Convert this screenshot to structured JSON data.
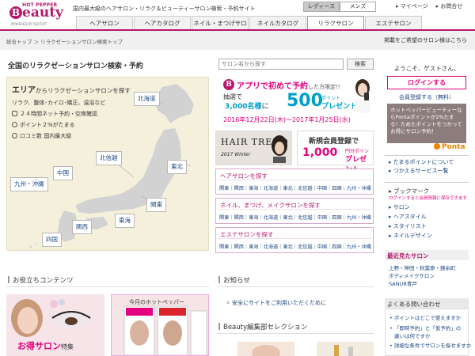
{
  "header": {
    "logo_small": "HOT PEPPER",
    "logo_letter": "B",
    "logo_word": "eauty",
    "logo_by": "POWERED BY RECRUIT",
    "tagline": "国内最大級のヘアサロン・リラク＆ビューティーサロン検索・予約サイト",
    "gender_tabs": [
      {
        "label": "レディース"
      },
      {
        "label": "メンズ"
      }
    ],
    "util_links": [
      "マイページ",
      "お問合せ"
    ],
    "nav_tabs": [
      {
        "label": "ヘアサロン"
      },
      {
        "label": "ヘアカタログ"
      },
      {
        "label": "ネイル・まつげサロン"
      },
      {
        "label": "ネイルカタログ"
      },
      {
        "label": "リラクサロン"
      },
      {
        "label": "エステサロン"
      }
    ]
  },
  "breadcrumb": {
    "text": "総合トップ ＞ リラクゼーションサロン検索トップ",
    "right": "掲載をご希望のサロン様はこちら"
  },
  "main": {
    "title": "全国のリラクゼーションサロン検索・予約",
    "search_placeholder": "サロン名から探す",
    "search_button": "検索"
  },
  "area": {
    "heading_bold": "エリア",
    "heading_rest": "からリラクゼーションサロンを探す",
    "features": [
      "リラク、整体･カイロ･矯正、温浴など",
      "２４時間ネット予約・空席確認",
      "ポイント２%がたまる",
      "口コミ数 国内最大級"
    ],
    "regions": {
      "hokkaido": "北海道",
      "tohoku": "東北",
      "hokushinetsu": "北信越",
      "kanto": "関東",
      "tokai": "東海",
      "kansai": "関西",
      "chugoku": "中国",
      "shikoku": "四国",
      "kyushu": "九州・沖縄"
    }
  },
  "promo_app": {
    "badge": "B",
    "line1": "アプリで初めて予約",
    "line1_tail": "した方限定!!",
    "line2": "抽選で",
    "count": "3,000名様",
    "count_tail": "に",
    "amount": "500",
    "point": "ポイント",
    "present": "プレゼント",
    "dates": "2016年12月22日(木)～2017年1月25日(水)"
  },
  "promo_hair": {
    "title": "HAIR TREND",
    "sub": "2017 Winter"
  },
  "promo_member": {
    "line1": "新規会員登録で",
    "amount": "1,000",
    "unit": "円分ポイント",
    "present": "プレゼント"
  },
  "categories": [
    {
      "title": "ヘアサロンを探す",
      "areas": "関東｜関西｜東海｜北海道｜東北｜北信越｜中国｜四国｜九州・沖縄"
    },
    {
      "title": "ネイル、まつげ、メイクサロンを探す",
      "areas": "関東｜関西｜東海｜北海道｜東北｜北信越｜中国｜四国｜九州・沖縄"
    },
    {
      "title": "エステサロンを探す",
      "areas": "関東｜関西｜東海｜北海道｜東北｜北信越｜中国｜四国｜九州・沖縄"
    }
  ],
  "sidebar": {
    "welcome": "ようこそ、ゲストさん。",
    "login": "ログインする",
    "register": "会員登録する（無料）",
    "ponta_text": "ホットペッパービューティーならPontaポイントが2%たまる！ためたポイントをつかってお得にサロン予約！",
    "ponta_logo": "Ponta",
    "links": [
      "たまるポイントについて",
      "つかえるサービス一覧"
    ],
    "bookmark_title": "ブックマーク",
    "bookmark_note": "ログインすると会員情報に保存できます",
    "bookmark_items": [
      "サロン",
      "ヘアスタイル",
      "スタイリスト",
      "ネイルデザイン"
    ],
    "recent_title": "最近見たサロン",
    "recent_items": [
      "上野・神田・秋葉原・錦糸町",
      "ボディメイクサロン",
      "SANUR青戸"
    ],
    "faq_title": "よくある問い合わせ",
    "faq_items": [
      "ポイントはどこで使えますか",
      "「即時予約」と「仮予約」の",
      "違いは何ですか",
      "詳細な条件でサロンを探せますか"
    ]
  },
  "bottom": {
    "useful_title": "お役立ちコンテンツ",
    "otoku_label": "お得サロン",
    "otoku_tail": "特集",
    "magazine_title": "今月のホットペッパー",
    "news_title": "お知らせ",
    "news_item": "安全にサイトをご利用いただくために",
    "selection_title": "Beauty編集部セレクション"
  },
  "colors": {
    "brand": "#b5196d",
    "accent": "#e4007f",
    "link": "#1a4480",
    "cyan": "#00a0c8"
  }
}
